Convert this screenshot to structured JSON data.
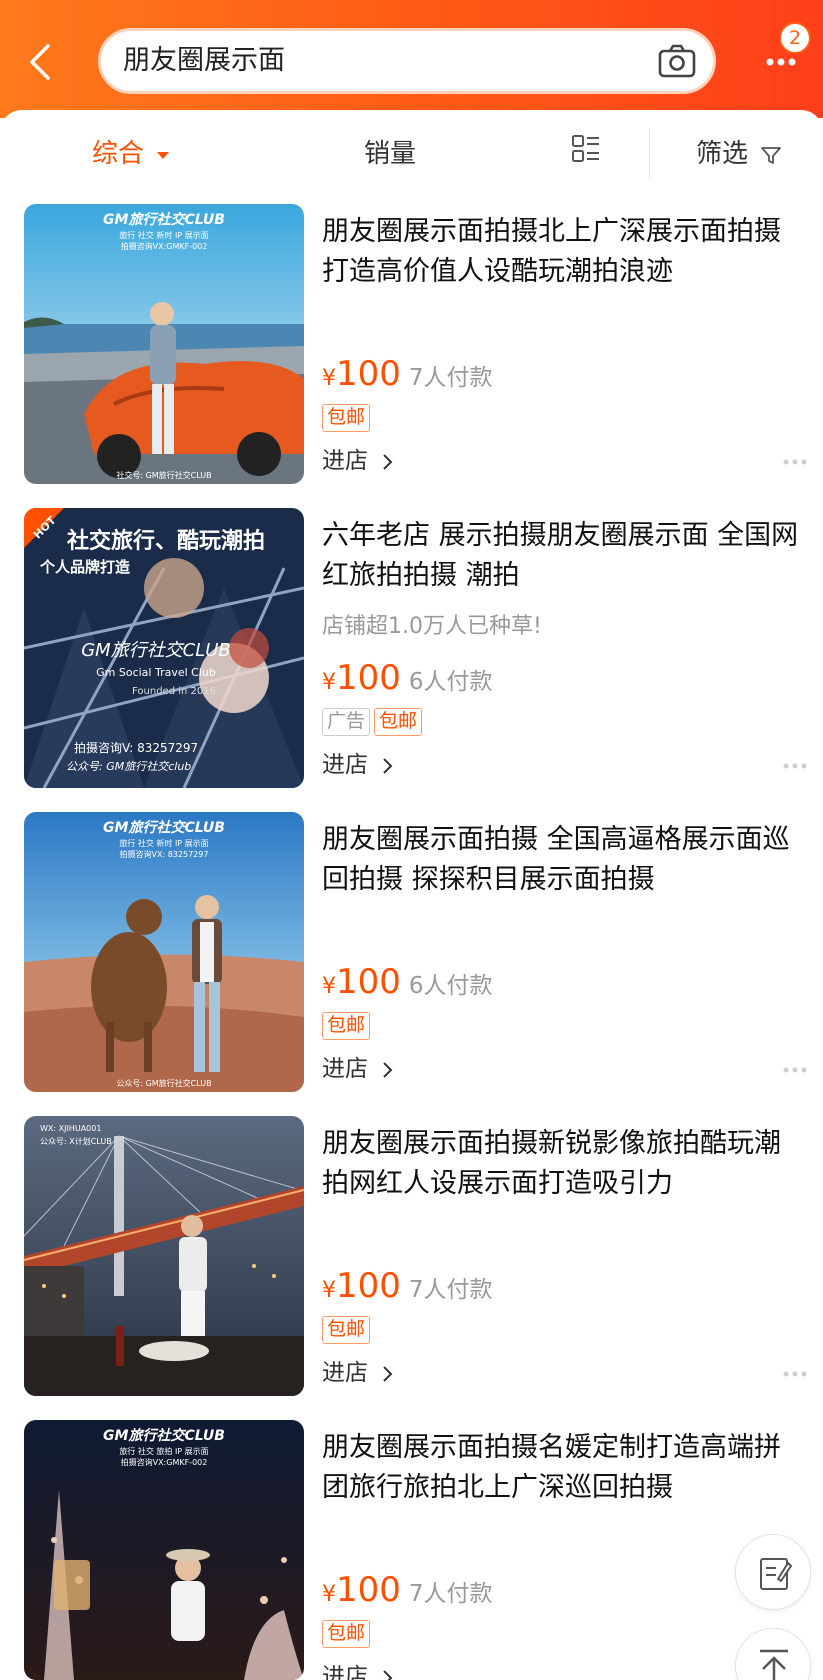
{
  "search": {
    "query": "朋友圈展示面",
    "cart_badge": "2"
  },
  "sort": {
    "composite": "综合",
    "sales": "销量",
    "filter": "筛选"
  },
  "labels": {
    "yen": "¥",
    "enter_shop": "进店"
  },
  "products": [
    {
      "title": "朋友圈展示面拍摄北上广深展示面拍摄打造高价值人设酷玩潮拍浪迹",
      "subtitle": "",
      "price": "100",
      "sold": "7人付款",
      "tags": [
        "包邮"
      ],
      "image": {
        "line1": "GM旅行社交CLUB",
        "line2": "旅行 社交 新时 IP 展示面",
        "line3": "拍摄咨询VX:GMKF-002",
        "footer": "社交号: GM旅行社交CLUB"
      }
    },
    {
      "title": "六年老店 展示拍摄朋友圈展示面 全国网红旅拍拍摄 潮拍",
      "subtitle": "店铺超1.0万人已种草!",
      "price": "100",
      "sold": "6人付款",
      "tags": [
        "广告",
        "包邮"
      ],
      "image": {
        "hot": "HOT",
        "line1": "社交旅行、酷玩潮拍",
        "line2": "个人品牌打造",
        "line3": "GM旅行社交CLUB",
        "line4": "Gm Social Travel Club",
        "line5": "Founded in 2016",
        "line6": "拍摄咨询V: 83257297",
        "line7": "公众号: GM旅行社交club"
      }
    },
    {
      "title": "朋友圈展示面拍摄 全国高逼格展示面巡回拍摄 探探积目展示面拍摄",
      "subtitle": "",
      "price": "100",
      "sold": "6人付款",
      "tags": [
        "包邮"
      ],
      "image": {
        "line1": "GM旅行社交CLUB",
        "line2": "旅行 社交 新时 IP 展示面",
        "line3": "拍摄咨询VX: 83257297",
        "footer": "公众号: GM旅行社交CLUB"
      }
    },
    {
      "title": "朋友圈展示面拍摄新锐影像旅拍酷玩潮拍网红人设展示面打造吸引力",
      "subtitle": "",
      "price": "100",
      "sold": "7人付款",
      "tags": [
        "包邮"
      ],
      "image": {
        "line1": "WX: XJIHUA001",
        "line2": "公众号: X计划CLUB"
      }
    },
    {
      "title": "朋友圈展示面拍摄名媛定制打造高端拼团旅行旅拍北上广深巡回拍摄",
      "subtitle": "",
      "price": "100",
      "sold": "7人付款",
      "tags": [
        "包邮"
      ],
      "image": {
        "line1": "GM旅行社交CLUB",
        "line2": "旅行 社交 旅拍 IP 展示面",
        "line3": "拍摄咨询VX:GMKF-002"
      }
    }
  ],
  "colors": {
    "brand_orange": "#ff5000",
    "header_gradient_start": "#ff7a1c",
    "header_gradient_end": "#ff3f1a"
  },
  "icons": [
    "back-arrow-icon",
    "camera-icon",
    "more-dots-icon",
    "dropdown-caret-icon",
    "list-view-icon",
    "filter-funnel-icon",
    "chevron-right-icon",
    "edit-note-icon",
    "back-to-top-icon"
  ]
}
